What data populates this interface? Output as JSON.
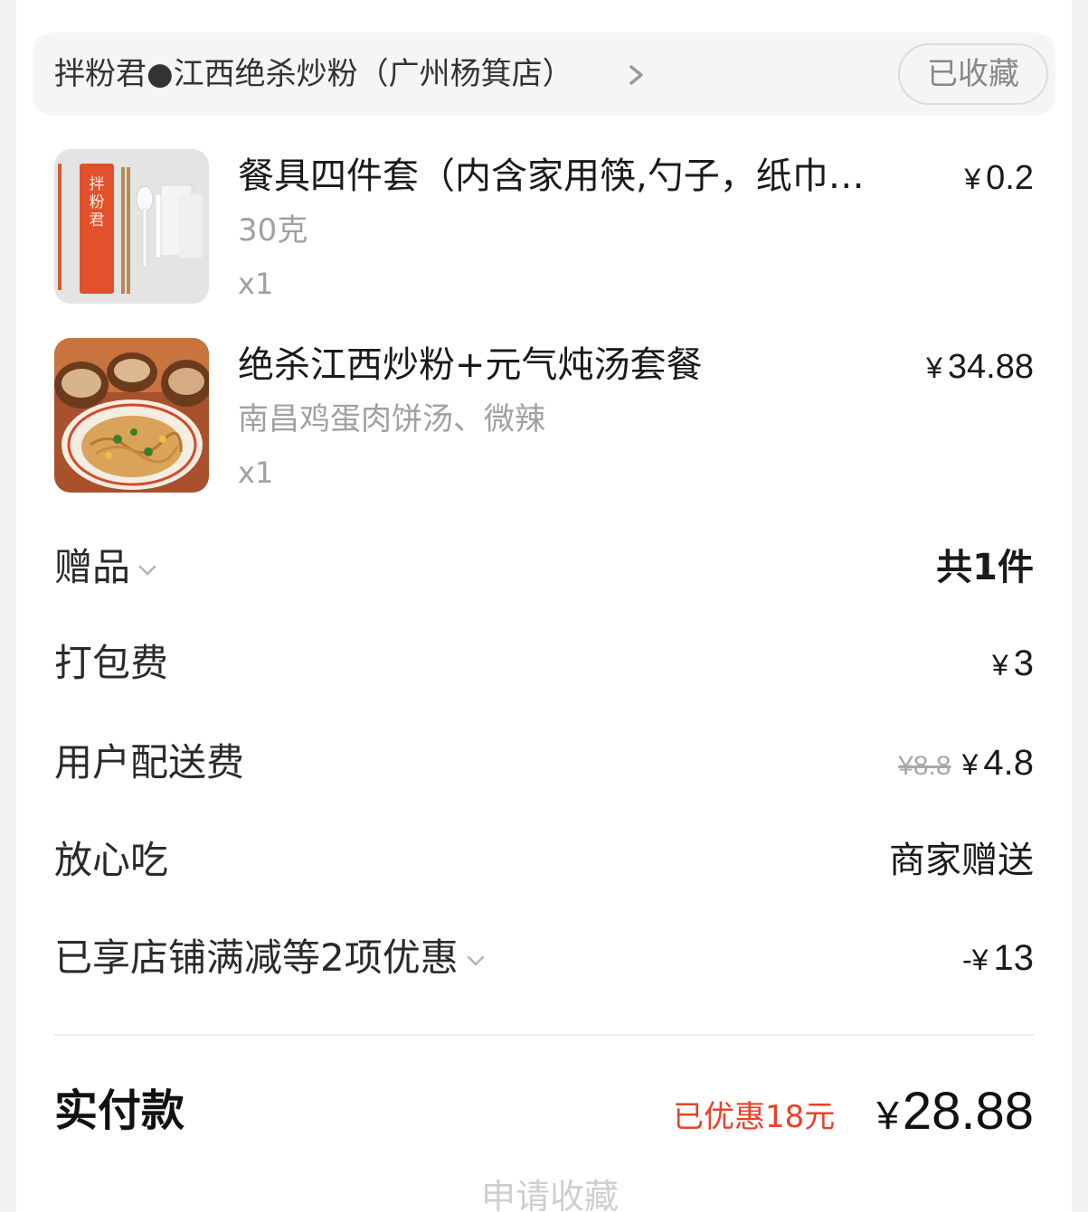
{
  "store": {
    "name": "拌粉君●江西绝杀炒粉（广州杨箕店）",
    "favorite_label": "已收藏"
  },
  "items": [
    {
      "name": "餐具四件套（内含家用筷,勺子，纸巾…",
      "spec": "30克",
      "qty": "x1",
      "currency": "¥",
      "price": "0.2",
      "thumb_text": "拌粉君"
    },
    {
      "name": "绝杀江西炒粉+元气炖汤套餐",
      "spec": "南昌鸡蛋肉饼汤、微辣",
      "qty": "x1",
      "currency": "¥",
      "price": "34.88"
    }
  ],
  "summary": {
    "gift": {
      "label": "赠品",
      "value": "共1件"
    },
    "packing": {
      "label": "打包费",
      "currency": "¥",
      "value": "3"
    },
    "delivery": {
      "label": "用户配送费",
      "original": "¥8.8",
      "currency": "¥",
      "value": "4.8"
    },
    "assurance": {
      "label": "放心吃",
      "value": "商家赠送"
    },
    "discount": {
      "label": "已享店铺满减等2项优惠",
      "prefix": "-¥",
      "value": "13"
    }
  },
  "total": {
    "label": "实付款",
    "saved": "已优惠18元",
    "currency": "¥",
    "value": "28.88"
  },
  "bottom_action": {
    "label": "申请收藏"
  },
  "colors": {
    "accent_red": "#ea4b2a",
    "text_primary": "#1a1a1a",
    "text_secondary": "#a0a0a0",
    "background": "#f2f2f2"
  },
  "icons": [
    "chevron-right-icon",
    "chevron-down-icon"
  ]
}
